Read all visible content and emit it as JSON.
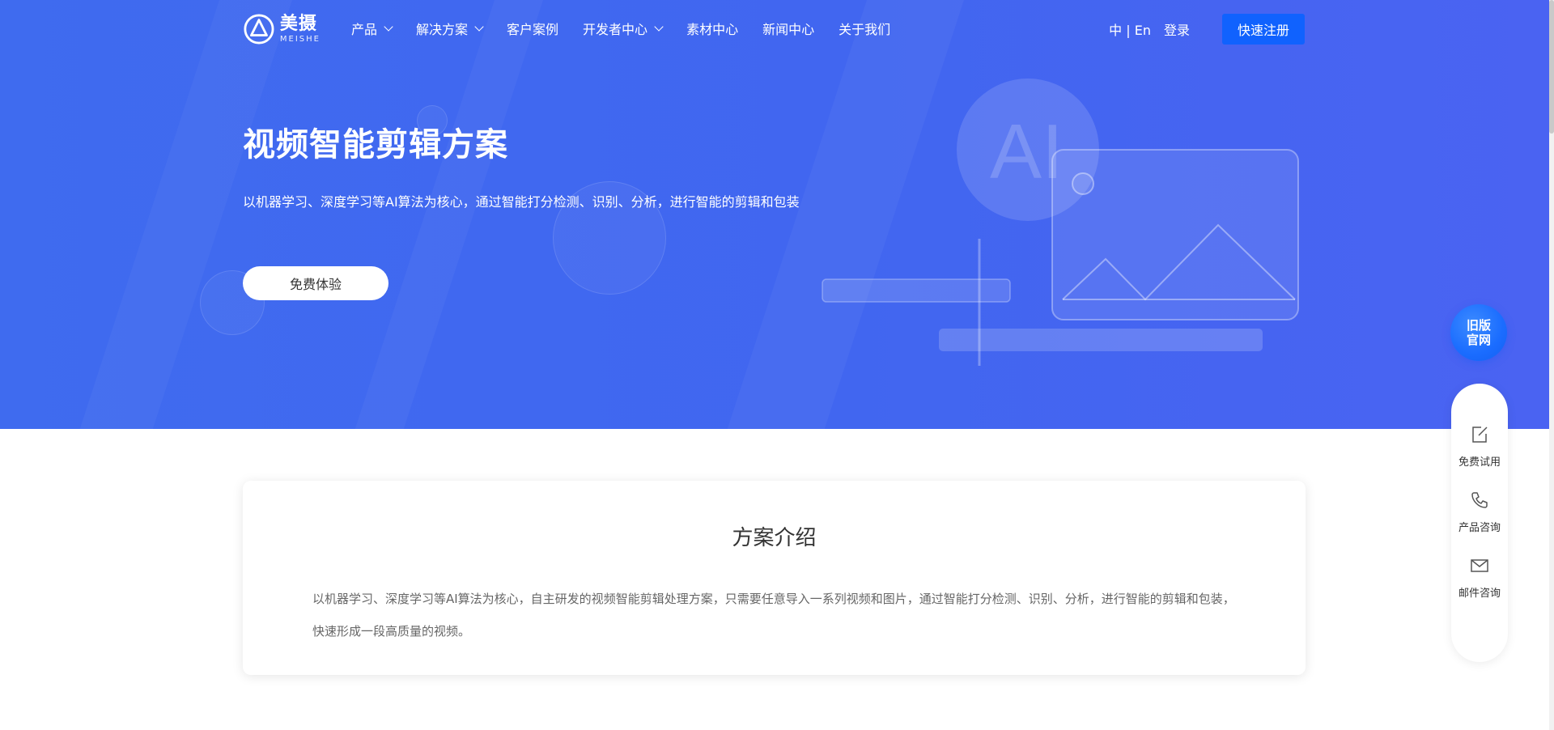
{
  "nav": {
    "logo": {
      "cn": "美摄",
      "en": "MEISHE"
    },
    "items": [
      {
        "label": "产品",
        "dropdown": true
      },
      {
        "label": "解决方案",
        "dropdown": true
      },
      {
        "label": "客户案例",
        "dropdown": false
      },
      {
        "label": "开发者中心",
        "dropdown": true
      },
      {
        "label": "素材中心",
        "dropdown": false
      },
      {
        "label": "新闻中心",
        "dropdown": false
      },
      {
        "label": "关于我们",
        "dropdown": false
      }
    ],
    "lang": "中 | En",
    "login": "登录",
    "register": "快速注册"
  },
  "hero": {
    "title": "视频智能剪辑方案",
    "description": "以机器学习、深度学习等AI算法为核心，通过智能打分检测、识别、分析，进行智能的剪辑和包装",
    "button": "免费体验",
    "illustration_text": "AI"
  },
  "intro": {
    "title": "方案介绍",
    "body": "以机器学习、深度学习等AI算法为核心，自主研发的视频智能剪辑处理方案，只需要任意导入一系列视频和图片，通过智能打分检测、识别、分析，进行智能的剪辑和包装，快速形成一段高质量的视频。"
  },
  "side": {
    "old_site": [
      "旧版",
      "官网"
    ],
    "items": [
      {
        "label": "免费试用",
        "icon": "edit-icon"
      },
      {
        "label": "产品咨询",
        "icon": "phone-icon"
      },
      {
        "label": "邮件咨询",
        "icon": "mail-icon"
      }
    ]
  },
  "colors": {
    "hero_bg": "#4166f0",
    "primary_button": "#1062fe",
    "old_site_button": "#1a6cff"
  }
}
